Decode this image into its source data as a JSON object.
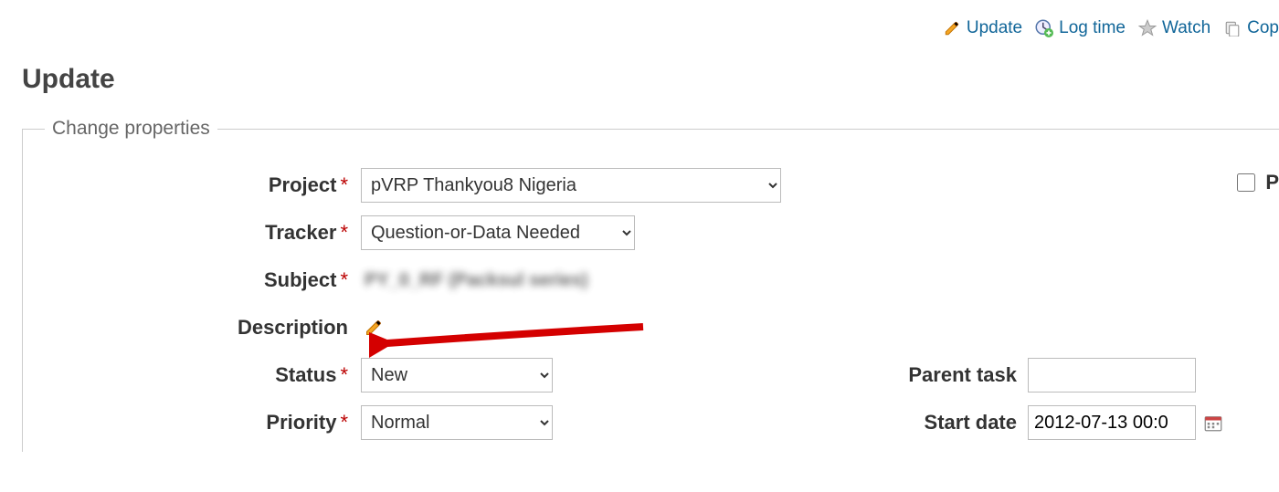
{
  "contextual": {
    "update": "Update",
    "logtime": "Log time",
    "watch": "Watch",
    "copy": "Cop"
  },
  "page_title": "Update",
  "legend": "Change properties",
  "labels": {
    "project": "Project",
    "tracker": "Tracker",
    "subject": "Subject",
    "description": "Description",
    "status": "Status",
    "priority": "Priority",
    "parent_task": "Parent task",
    "start_date": "Start date",
    "private": "P"
  },
  "required_marker": "*",
  "fields": {
    "project_value": "pVRP Thankyou8 Nigeria",
    "tracker_value": "Question-or-Data Needed",
    "subject_value": "PY_0_RF (Packsul series)",
    "status_value": "New",
    "priority_value": "Normal",
    "parent_task_value": "",
    "start_date_value": "2012-07-13 00:0"
  }
}
